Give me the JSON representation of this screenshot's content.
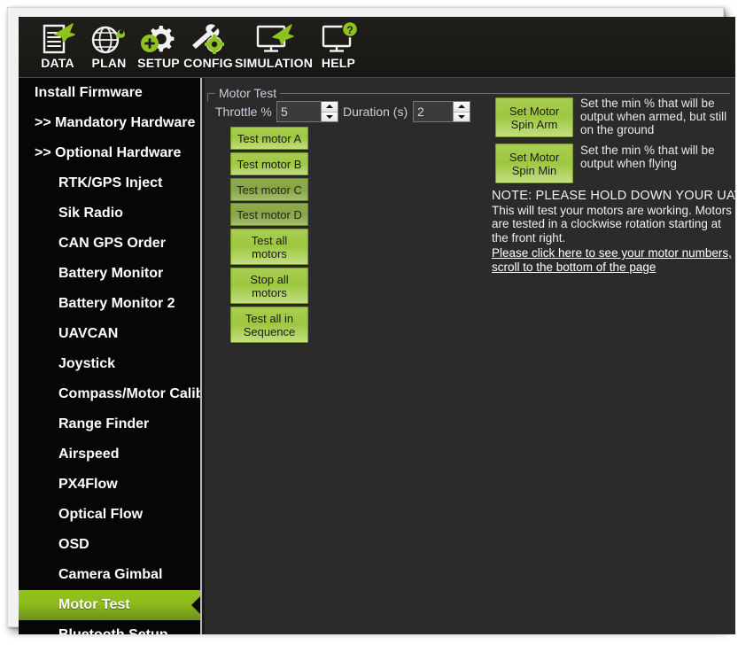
{
  "toolbar": {
    "items": [
      {
        "label": "DATA",
        "icon": "document-plane-icon"
      },
      {
        "label": "PLAN",
        "icon": "globe-marker-icon"
      },
      {
        "label": "SETUP",
        "icon": "gear-plus-icon"
      },
      {
        "label": "CONFIG",
        "icon": "wrench-gear-icon"
      },
      {
        "label": "SIMULATION",
        "icon": "monitor-plane-icon"
      },
      {
        "label": "HELP",
        "icon": "monitor-question-icon"
      }
    ]
  },
  "sidebar": {
    "items": [
      {
        "label": "Install Firmware",
        "level": 0,
        "selected": false
      },
      {
        "label": ">> Mandatory Hardware",
        "level": 0,
        "selected": false
      },
      {
        "label": ">> Optional Hardware",
        "level": 0,
        "selected": false
      },
      {
        "label": "RTK/GPS Inject",
        "level": 1,
        "selected": false
      },
      {
        "label": "Sik Radio",
        "level": 1,
        "selected": false
      },
      {
        "label": "CAN GPS Order",
        "level": 1,
        "selected": false
      },
      {
        "label": "Battery Monitor",
        "level": 1,
        "selected": false
      },
      {
        "label": "Battery Monitor 2",
        "level": 1,
        "selected": false
      },
      {
        "label": "UAVCAN",
        "level": 1,
        "selected": false
      },
      {
        "label": "Joystick",
        "level": 1,
        "selected": false
      },
      {
        "label": "Compass/Motor Calib",
        "level": 1,
        "selected": false
      },
      {
        "label": "Range Finder",
        "level": 1,
        "selected": false
      },
      {
        "label": "Airspeed",
        "level": 1,
        "selected": false
      },
      {
        "label": "PX4Flow",
        "level": 1,
        "selected": false
      },
      {
        "label": "Optical Flow",
        "level": 1,
        "selected": false
      },
      {
        "label": "OSD",
        "level": 1,
        "selected": false
      },
      {
        "label": "Camera Gimbal",
        "level": 1,
        "selected": false
      },
      {
        "label": "Motor Test",
        "level": 1,
        "selected": true
      },
      {
        "label": "Bluetooth Setup",
        "level": 1,
        "selected": false
      }
    ]
  },
  "main": {
    "group_title": "Motor Test",
    "throttle": {
      "label": "Throttle %",
      "value": "5",
      "placeholder": ""
    },
    "duration": {
      "label": "Duration (s)",
      "value": "2",
      "placeholder": ""
    },
    "buttons": [
      {
        "label": "Test motor A",
        "state": "normal"
      },
      {
        "label": "Test motor B",
        "state": "normal"
      },
      {
        "label": "Test motor C",
        "state": "dim"
      },
      {
        "label": "Test motor D",
        "state": "dim"
      },
      {
        "label": "Test all\nmotors",
        "state": "normal"
      },
      {
        "label": "Stop all\nmotors",
        "state": "normal"
      },
      {
        "label": "Test all in\nSequence",
        "state": "normal"
      }
    ],
    "spin_settings": [
      {
        "button_label": "Set Motor\nSpin Arm",
        "description": "Set the min % that will be output when armed, but still on the ground"
      },
      {
        "button_label": "Set Motor\nSpin Min",
        "description": "Set the min % that will be output when flying"
      }
    ],
    "note": {
      "title": "NOTE: PLEASE HOLD DOWN YOUR UAV",
      "body": "This will test your motors are working. Motors are tested in a clockwise rotation starting at the front right."
    },
    "link": "Please click here to see your motor numbers, scroll to the bottom of the page"
  },
  "colors": {
    "accent_green": "#94c11f",
    "button_green": "#9dc73f",
    "panel_bg": "#2b2b2b",
    "sidebar_bg": "#060606",
    "toolbar_bg": "#1d1b18",
    "label_text": "#c8cfdc"
  }
}
